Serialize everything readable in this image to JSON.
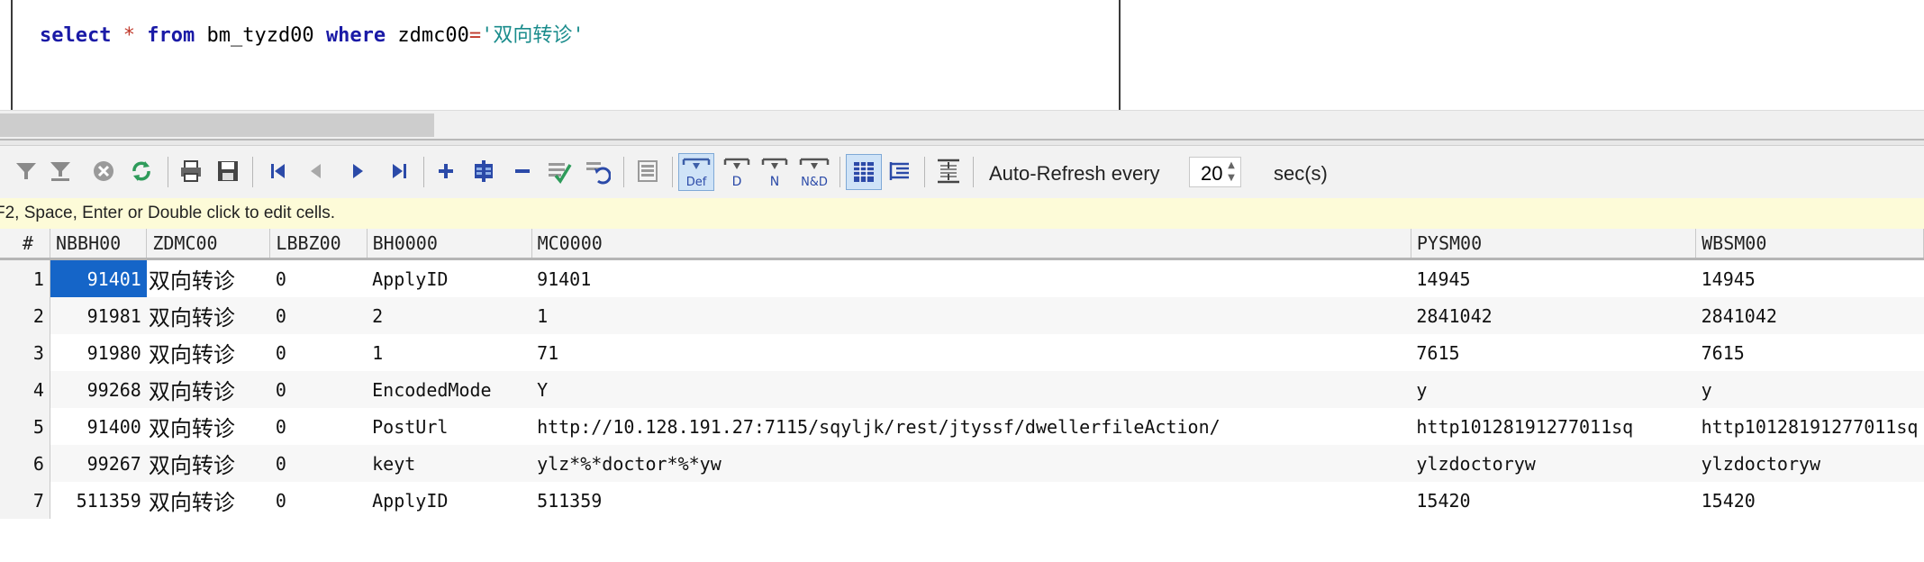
{
  "editor": {
    "sql": {
      "kw_select": "select",
      "star": "*",
      "kw_from": "from",
      "table": "bm_tyzd00",
      "kw_where": "where",
      "column": "zdmc00",
      "eq": "=",
      "literal": "'双向转诊'"
    }
  },
  "toolbar": {
    "auto_refresh_label": "Auto-Refresh every",
    "refresh_interval": "20",
    "sec_label": "sec(s)",
    "icons": [
      "filter-icon",
      "filter-clear-icon",
      "cancel-icon",
      "refresh-icon",
      "print-icon",
      "save-icon",
      "first-record-icon",
      "prev-record-icon",
      "next-record-icon",
      "last-record-icon",
      "insert-row-icon",
      "duplicate-row-icon",
      "delete-row-icon",
      "post-edit-icon",
      "cancel-edit-icon",
      "blob-viewer-icon",
      "set-default-icon",
      "set-null-icon",
      "set-empty-icon",
      "set-null-default-icon",
      "grid-view-icon",
      "form-view-icon",
      "fit-columns-icon"
    ],
    "mode_labels": {
      "def": "Def",
      "d": "D",
      "n": "N",
      "nd": "N&D"
    }
  },
  "hint": "F2, Space, Enter or Double click to edit cells.",
  "grid": {
    "columns": [
      "#",
      "NBBH00",
      "ZDMC00",
      "LBBZ00",
      "BH0000",
      "MC0000",
      "PYSM00",
      "WBSM00"
    ],
    "rows": [
      {
        "n": "1",
        "NBBH00": "91401",
        "ZDMC00": "双向转诊",
        "LBBZ00": "0",
        "BH0000": "ApplyID",
        "MC0000": "91401",
        "PYSM00": "14945",
        "WBSM00": "14945"
      },
      {
        "n": "2",
        "NBBH00": "91981",
        "ZDMC00": "双向转诊",
        "LBBZ00": "0",
        "BH0000": "2",
        "MC0000": "1",
        "PYSM00": "2841042",
        "WBSM00": "2841042"
      },
      {
        "n": "3",
        "NBBH00": "91980",
        "ZDMC00": "双向转诊",
        "LBBZ00": "0",
        "BH0000": "1",
        "MC0000": "71",
        "PYSM00": "7615",
        "WBSM00": "7615"
      },
      {
        "n": "4",
        "NBBH00": "99268",
        "ZDMC00": "双向转诊",
        "LBBZ00": "0",
        "BH0000": "EncodedMode",
        "MC0000": "Y",
        "PYSM00": "y",
        "WBSM00": "y"
      },
      {
        "n": "5",
        "NBBH00": "91400",
        "ZDMC00": "双向转诊",
        "LBBZ00": "0",
        "BH0000": "PostUrl",
        "MC0000": "http://10.128.191.27:7115/sqyljk/rest/jtyssf/dwellerfileAction/",
        "PYSM00": "http10128191277011sq",
        "WBSM00": "http10128191277011sq"
      },
      {
        "n": "6",
        "NBBH00": "99267",
        "ZDMC00": "双向转诊",
        "LBBZ00": "0",
        "BH0000": "keyt",
        "MC0000": "ylz*%*doctor*%*yw",
        "PYSM00": "ylzdoctoryw",
        "WBSM00": "ylzdoctoryw"
      },
      {
        "n": "7",
        "NBBH00": "511359",
        "ZDMC00": "双向转诊",
        "LBBZ00": "0",
        "BH0000": "ApplyID",
        "MC0000": "511359",
        "PYSM00": "15420",
        "WBSM00": "15420"
      }
    ]
  }
}
